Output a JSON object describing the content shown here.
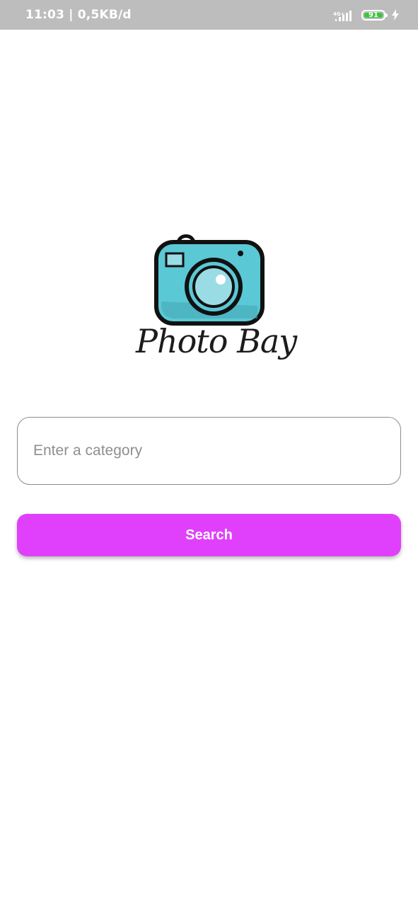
{
  "status_bar": {
    "time_and_speed": "11:03 | 0,5KB/d",
    "network_type": "4G+",
    "battery_level": "91",
    "icons": [
      "signal-icon",
      "battery-icon",
      "charging-icon"
    ]
  },
  "logo": {
    "icon": "camera-icon",
    "text": "Photo Bay",
    "colors": {
      "camera_body": "#5bc8d5",
      "camera_outline": "#111111",
      "lens": "#9adce4"
    }
  },
  "search": {
    "placeholder": "Enter a category",
    "value": "",
    "button_label": "Search"
  },
  "colors": {
    "accent": "#e040fb",
    "status_bar": "#bdbdbd"
  }
}
